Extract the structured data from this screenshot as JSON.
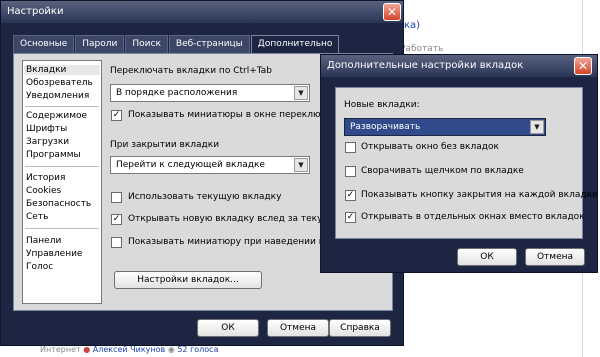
{
  "background": {
    "link_top": "ка)",
    "link_row": "Работать",
    "link_row_grey": "Работать",
    "bottom_text_prefix": "Интернет",
    "bottom_user": "Алексей Чикунов",
    "bottom_votes": "52 голоса"
  },
  "main_window": {
    "title": "Настройки",
    "close_glyph": "✕",
    "tabs": [
      {
        "label": "Основные"
      },
      {
        "label": "Пароли"
      },
      {
        "label": "Поиск"
      },
      {
        "label": "Веб-страницы"
      },
      {
        "label": "Дополнительно",
        "active": true
      }
    ],
    "sidebar": {
      "items": [
        {
          "label": "Вкладки",
          "selected": true
        },
        {
          "label": "Обозреватель"
        },
        {
          "label": "Уведомления"
        },
        {
          "label": "Содержимое"
        },
        {
          "label": "Шрифты"
        },
        {
          "label": "Загрузки"
        },
        {
          "label": "Программы"
        },
        {
          "label": "История"
        },
        {
          "label": "Cookies"
        },
        {
          "label": "Безопасность"
        },
        {
          "label": "Сеть"
        },
        {
          "label": "Панели"
        },
        {
          "label": "Управление"
        },
        {
          "label": "Голос"
        }
      ]
    },
    "switch_label": "Переключать вкладки по Ctrl+Tab",
    "switch_value": "В порядке расположения",
    "show_thumbs": {
      "label": "Показывать миниатюры в окне переключения",
      "checked": true
    },
    "close_label": "При закрытии вкладки",
    "close_value": "Перейти к следующей вкладке",
    "use_current": {
      "label": "Использовать текущую вкладку",
      "checked": false
    },
    "open_next": {
      "label": "Открывать новую вкладку вслед за текущей",
      "checked": true
    },
    "hover_thumb": {
      "label": "Показывать миниатюру при наведении на вклад",
      "checked": false
    },
    "tab_settings_button": "Настройки вкладок...",
    "ok": "ОК",
    "cancel": "Отмена",
    "help": "Справка"
  },
  "dialog": {
    "title": "Дополнительные настройки вкладок",
    "close_glyph": "✕",
    "new_tabs_label": "Новые вкладки:",
    "new_tabs_value": "Разворачивать",
    "options": [
      {
        "label": "Открывать окно без вкладок",
        "checked": false
      },
      {
        "label": "Сворачивать щелчком по вкладке",
        "checked": false
      },
      {
        "label": "Показывать кнопку закрытия на каждой вкладке",
        "checked": true
      },
      {
        "label": "Открывать в отдельных окнах вместо вкладок",
        "checked": true
      }
    ],
    "ok": "ОК",
    "cancel": "Отмена"
  },
  "glyphs": {
    "check": "✓",
    "dropdown_arrow": "▼"
  },
  "colors": {
    "window_dark": "#1c2541",
    "panel": "#dadada",
    "selection_blue": "#304a8c",
    "close_red": "#d2452a"
  }
}
